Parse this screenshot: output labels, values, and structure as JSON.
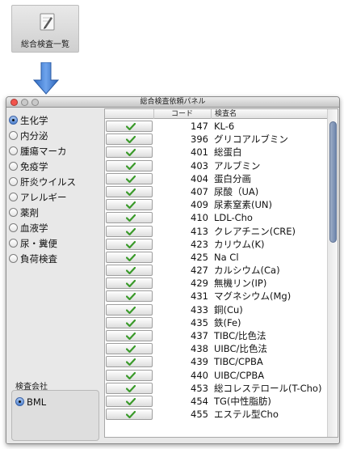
{
  "launcher": {
    "label": "総合検査一覧",
    "icon": "edit-document-icon"
  },
  "window": {
    "title": "総合検査依頼パネル",
    "controls": [
      "close",
      "minimize",
      "zoom"
    ]
  },
  "categories": {
    "selected": "生化学",
    "items": [
      "生化学",
      "内分泌",
      "腫瘍マーカ",
      "免疫学",
      "肝炎ウイルス",
      "アレルギー",
      "薬剤",
      "血液学",
      "尿・糞便",
      "負荷検査"
    ]
  },
  "company": {
    "label": "検査会社",
    "selected": "BML",
    "options": [
      "BML"
    ]
  },
  "table": {
    "columns": [
      "",
      "コード",
      "検査名"
    ],
    "rows": [
      {
        "code": "147",
        "name": "KL-6"
      },
      {
        "code": "396",
        "name": "グリコアルブミン"
      },
      {
        "code": "401",
        "name": "総蛋白"
      },
      {
        "code": "403",
        "name": "アルブミン"
      },
      {
        "code": "404",
        "name": "蛋白分画"
      },
      {
        "code": "407",
        "name": "尿酸（UA)"
      },
      {
        "code": "409",
        "name": "尿素窒素(UN)"
      },
      {
        "code": "410",
        "name": "LDL-Cho"
      },
      {
        "code": "413",
        "name": "クレアチニン(CRE)"
      },
      {
        "code": "423",
        "name": "カリウム(K)"
      },
      {
        "code": "425",
        "name": "Na Cl"
      },
      {
        "code": "427",
        "name": "カルシウム(Ca)"
      },
      {
        "code": "429",
        "name": "無機リン(IP)"
      },
      {
        "code": "431",
        "name": "マグネシウム(Mg)"
      },
      {
        "code": "433",
        "name": "銅(Cu)"
      },
      {
        "code": "435",
        "name": "鉄(Fe)"
      },
      {
        "code": "437",
        "name": "TIBC/比色法"
      },
      {
        "code": "438",
        "name": "UIBC/比色法"
      },
      {
        "code": "439",
        "name": "TIBC/CPBA"
      },
      {
        "code": "440",
        "name": "UIBC/CPBA"
      },
      {
        "code": "453",
        "name": "総コレステロール(T-Cho)"
      },
      {
        "code": "454",
        "name": "TG(中性脂肪)"
      },
      {
        "code": "455",
        "name": "エステル型Cho"
      }
    ],
    "check_icon": "checkmark-icon",
    "check_color": "#3a9a2a"
  },
  "colors": {
    "close_button": "#f2544c",
    "selected_radio": "#4f82cf",
    "arrow": "#3d7ad1",
    "scroll_thumb": "#7f95b9"
  }
}
